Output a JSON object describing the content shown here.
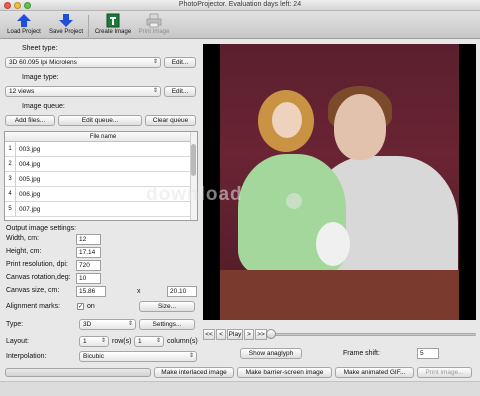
{
  "window": {
    "title": "PhotoProjector. Evaluation days left: 24"
  },
  "colors": {
    "accent_blue": "#1f4fd6",
    "create_green": "#1e7a3a"
  },
  "toolbar": {
    "load": {
      "label": "Load Project",
      "icon": "upload-arrow-icon"
    },
    "save": {
      "label": "Save Project",
      "icon": "download-arrow-icon"
    },
    "create": {
      "label": "Create Image",
      "icon": "create-image-icon"
    },
    "print": {
      "label": "Print Image",
      "icon": "printer-icon"
    }
  },
  "sheet": {
    "label": "Sheet type:",
    "value": "3D 60.095 lpi Microlens",
    "edit": "Edit..."
  },
  "image_type": {
    "label": "Image type:",
    "value": "12 views",
    "edit": "Edit..."
  },
  "queue": {
    "label": "Image queue:",
    "add": "Add files...",
    "edit": "Edit queue...",
    "clear": "Clear queue",
    "column": "File name",
    "rows": [
      {
        "n": "1",
        "file": "003.jpg"
      },
      {
        "n": "2",
        "file": "004.jpg"
      },
      {
        "n": "3",
        "file": "005.jpg"
      },
      {
        "n": "4",
        "file": "006.jpg"
      },
      {
        "n": "5",
        "file": "007.jpg"
      }
    ]
  },
  "output": {
    "heading": "Output image settings:",
    "width_label": "Width, cm:",
    "width": "12",
    "height_label": "Height, cm:",
    "height": "17.14",
    "res_label": "Print resolution, dpi:",
    "res": "720",
    "rot_label": "Canvas rotation,deg:",
    "rot": "10",
    "canvas_label": "Canvas size, cm:",
    "canvas_w": "15.86",
    "canvas_x": "x",
    "canvas_h": "20.10",
    "align_label": "Alignment marks:",
    "align_on": "on",
    "align_checked": true,
    "size_btn": "Size...",
    "type_label": "Type:",
    "type_value": "3D",
    "settings_btn": "Settings...",
    "layout_label": "Layout:",
    "layout_rows": "1",
    "rows_text": "row(s)",
    "layout_cols": "1",
    "cols_text": "column(s)",
    "interp_label": "Interpolation:",
    "interp_value": "Bicubic"
  },
  "player": {
    "first": "<<",
    "prev": "<",
    "play": "Play",
    "next": ">",
    "last": ">>",
    "position": 0,
    "anaglyph": "Show anaglyph",
    "shift_label": "Frame shift:",
    "shift": "5"
  },
  "watermark": "download",
  "actions": {
    "interlaced": "Make interlaced image",
    "barrier": "Make barrier-screen image",
    "gif": "Make animated GIF...",
    "print": "Print image..."
  }
}
